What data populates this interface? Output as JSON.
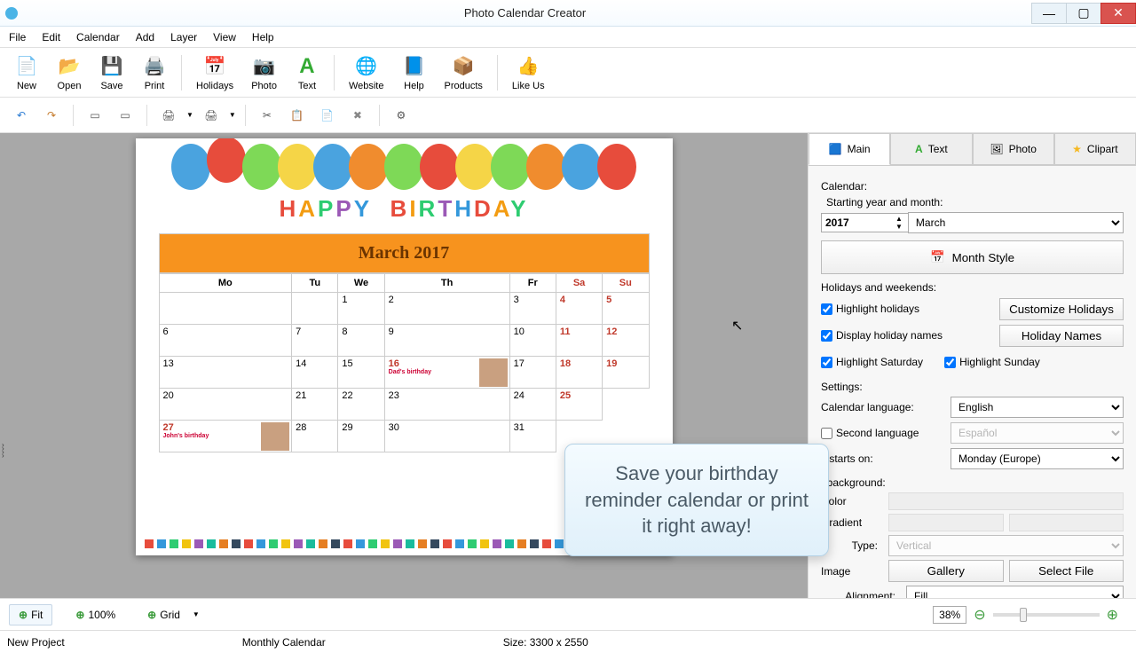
{
  "window": {
    "title": "Photo Calendar Creator"
  },
  "menu": [
    "File",
    "Edit",
    "Calendar",
    "Add",
    "Layer",
    "View",
    "Help"
  ],
  "toolbar": {
    "new": "New",
    "open": "Open",
    "save": "Save",
    "print": "Print",
    "holidays": "Holidays",
    "photo": "Photo",
    "text": "Text",
    "website": "Website",
    "help": "Help",
    "products": "Products",
    "likeus": "Like Us"
  },
  "tabs": {
    "main": "Main",
    "text": "Text",
    "photo": "Photo",
    "clipart": "Clipart"
  },
  "panel": {
    "calendar_label": "Calendar:",
    "starting_label": "Starting year and month:",
    "year": "2017",
    "month": "March",
    "month_style": "Month Style",
    "holidays_section": "Holidays and weekends:",
    "highlight_holidays": "Highlight holidays",
    "customize_holidays": "Customize Holidays",
    "display_holiday_names": "Display holiday names",
    "holiday_names_btn": "Holiday Names",
    "highlight_sat": "Highlight Saturday",
    "highlight_sun": "Highlight Sunday",
    "settings_section": "Settings:",
    "calendar_language_label": "Calendar language:",
    "calendar_language": "English",
    "second_language_label": "Second language",
    "second_language": "Español",
    "week_starts_label": "k starts on:",
    "week_starts": "Monday (Europe)",
    "background_label": "t background:",
    "color_label": "Color",
    "gradient_label": "Gradient",
    "type_label": "Type:",
    "type_value": "Vertical",
    "image_label": "Image",
    "gallery_btn": "Gallery",
    "select_file_btn": "Select File",
    "alignment_label": "Alignment:",
    "alignment_value": "Fill"
  },
  "calendar": {
    "title": "March 2017",
    "dow": [
      "Mo",
      "Tu",
      "We",
      "Th",
      "Fr",
      "Sa",
      "Su"
    ],
    "weeks": [
      [
        "",
        "",
        "1",
        "2",
        "3",
        "4",
        "5"
      ],
      [
        "6",
        "7",
        "8",
        "9",
        "10",
        "11",
        "12"
      ],
      [
        "13",
        "14",
        "15",
        "16",
        "17",
        "18",
        "19"
      ],
      [
        "20",
        "21",
        "22",
        "23",
        "24",
        "25",
        ""
      ],
      [
        "27",
        "28",
        "29",
        "30",
        "31",
        "",
        ""
      ]
    ],
    "event16": "Dad's birthday",
    "event27": "John's birthday",
    "banner": "HAPPY BIRTHDAY"
  },
  "footer": {
    "fit": "Fit",
    "hundred": "100%",
    "grid": "Grid",
    "zoom": "38%",
    "project": "New Project",
    "type": "Monthly Calendar",
    "size": "Size: 3300 x 2550"
  },
  "tooltip": "Save your birthday reminder calendar or print it right away!"
}
